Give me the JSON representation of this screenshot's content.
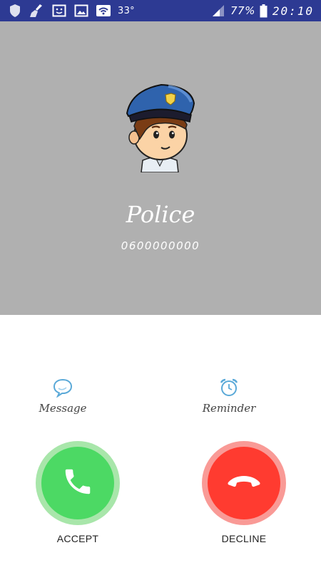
{
  "status_bar": {
    "temperature": "33°",
    "battery_percent": "77%",
    "time": "20:10",
    "icons": [
      "shield-icon",
      "cleaner-icon",
      "screenshot-icon",
      "gallery-icon",
      "wifi-icon",
      "signal-icon",
      "battery-icon"
    ]
  },
  "caller": {
    "name": "Police",
    "number": "0600000000",
    "avatar": "police-officer-avatar"
  },
  "actions": {
    "message_label": "Message",
    "reminder_label": "Reminder"
  },
  "buttons": {
    "accept_label": "ACCEPT",
    "decline_label": "DECLINE"
  },
  "colors": {
    "status_bar_bg": "#2d3a93",
    "caller_bg": "#b0b0b0",
    "accept_outer": "#a8e6aa",
    "accept_inner": "#4cd964",
    "decline_outer": "#f99a96",
    "decline_inner": "#ff3b30"
  }
}
